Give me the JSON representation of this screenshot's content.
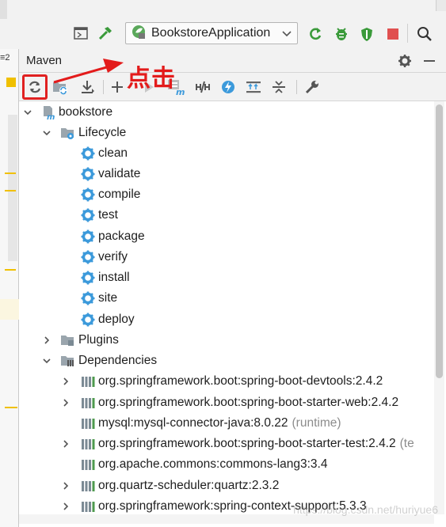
{
  "toolbar": {
    "run_config": "BookstoreApplication",
    "tab_number": "2"
  },
  "panel": {
    "title": "Maven"
  },
  "annotation": {
    "text": "点击"
  },
  "tree": {
    "root": "bookstore",
    "lifecycle": {
      "label": "Lifecycle",
      "goals": [
        "clean",
        "validate",
        "compile",
        "test",
        "package",
        "verify",
        "install",
        "site",
        "deploy"
      ]
    },
    "plugins": "Plugins",
    "dependencies": {
      "label": "Dependencies",
      "items": [
        {
          "name": "org.springframework.boot:spring-boot-devtools:2.4.2",
          "scope": "",
          "expandable": true
        },
        {
          "name": "org.springframework.boot:spring-boot-starter-web:2.4.2",
          "scope": "",
          "expandable": true
        },
        {
          "name": "mysql:mysql-connector-java:8.0.22",
          "scope": "(runtime)",
          "expandable": false
        },
        {
          "name": "org.springframework.boot:spring-boot-starter-test:2.4.2",
          "scope": "(te",
          "expandable": true
        },
        {
          "name": "org.apache.commons:commons-lang3:3.4",
          "scope": "",
          "expandable": false
        },
        {
          "name": "org.quartz-scheduler:quartz:2.3.2",
          "scope": "",
          "expandable": true
        },
        {
          "name": "org.springframework:spring-context-support:5.3.3",
          "scope": "",
          "expandable": true
        }
      ]
    }
  },
  "watermark": "https://blog.csdn.net/huriyue6",
  "colors": {
    "accent_red": "#e31b1b",
    "gear_blue": "#3c9adb",
    "run_green": "#3a9a3a"
  }
}
